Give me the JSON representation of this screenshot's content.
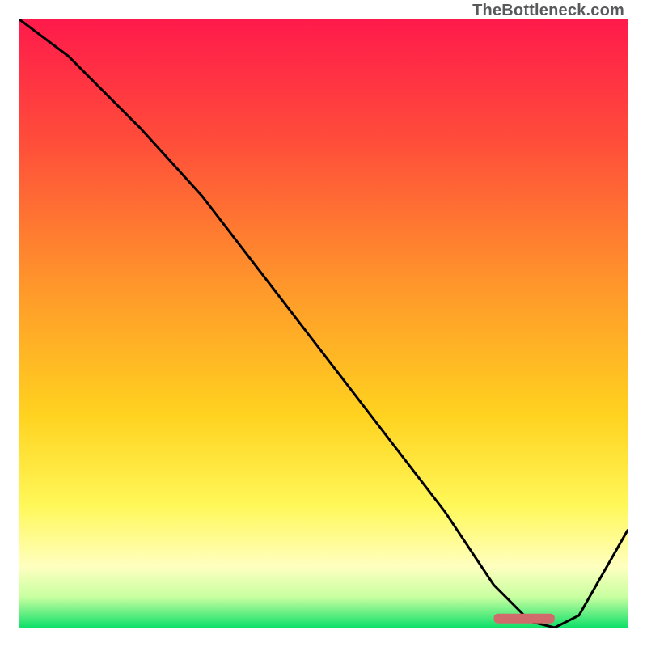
{
  "watermark": "TheBottleneck.com",
  "chart_data": {
    "type": "line",
    "title": "",
    "xlabel": "",
    "ylabel": "",
    "xlim": [
      0,
      100
    ],
    "ylim": [
      0,
      100
    ],
    "x": [
      0,
      8,
      20,
      30,
      40,
      50,
      60,
      70,
      78,
      84,
      88,
      92,
      100
    ],
    "values": [
      100,
      94,
      82,
      71,
      58,
      45,
      32,
      19,
      7,
      1,
      0,
      2,
      16
    ],
    "marker": {
      "x_start": 78,
      "x_end": 88,
      "y": 1.5
    },
    "gradient_stops": [
      {
        "pos": 0.0,
        "color": "#ff1a4b"
      },
      {
        "pos": 0.2,
        "color": "#ff4d3a"
      },
      {
        "pos": 0.45,
        "color": "#ff9a2a"
      },
      {
        "pos": 0.65,
        "color": "#ffd21f"
      },
      {
        "pos": 0.8,
        "color": "#fff859"
      },
      {
        "pos": 0.9,
        "color": "#ffffc0"
      },
      {
        "pos": 0.95,
        "color": "#c7ffa0"
      },
      {
        "pos": 1.0,
        "color": "#0fe069"
      }
    ]
  }
}
